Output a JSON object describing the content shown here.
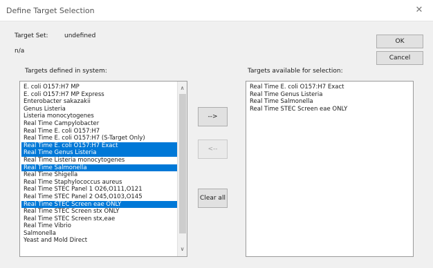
{
  "window": {
    "title": "Define Target Selection",
    "close_glyph": "✕"
  },
  "target_set": {
    "label": "Target Set:",
    "value": "undefined",
    "note": "n/a"
  },
  "buttons": {
    "ok": "OK",
    "cancel": "Cancel",
    "add": "-->",
    "remove": "<--",
    "clear_all": "Clear all"
  },
  "left_panel": {
    "label": "Targets defined in system:",
    "items": [
      {
        "text": "E. coli O157:H7 MP",
        "selected": false
      },
      {
        "text": "E. coli O157:H7 MP Express",
        "selected": false
      },
      {
        "text": "Enterobacter sakazakii",
        "selected": false
      },
      {
        "text": "Genus Listeria",
        "selected": false
      },
      {
        "text": "Listeria monocytogenes",
        "selected": false
      },
      {
        "text": "Real Time Campylobacter",
        "selected": false
      },
      {
        "text": "Real Time E. coli O157:H7",
        "selected": false
      },
      {
        "text": "Real Time E. coli O157:H7 (S-Target Only)",
        "selected": false
      },
      {
        "text": "Real Time E. coli O157:H7 Exact",
        "selected": true
      },
      {
        "text": "Real Time Genus Listeria",
        "selected": true
      },
      {
        "text": "Real Time Listeria monocytogenes",
        "selected": false
      },
      {
        "text": "Real Time Salmonella",
        "selected": true
      },
      {
        "text": "Real Time Shigella",
        "selected": false
      },
      {
        "text": "Real Time Staphylococcus aureus",
        "selected": false
      },
      {
        "text": "Real Time STEC Panel 1 O26,O111,O121",
        "selected": false
      },
      {
        "text": "Real Time STEC Panel 2 O45,O103,O145",
        "selected": false
      },
      {
        "text": "Real Time STEC Screen eae ONLY",
        "selected": true
      },
      {
        "text": "Real Time STEC Screen stx ONLY",
        "selected": false
      },
      {
        "text": "Real Time STEC Screen stx,eae",
        "selected": false
      },
      {
        "text": "Real Time Vibrio",
        "selected": false
      },
      {
        "text": "Salmonella",
        "selected": false
      },
      {
        "text": "Yeast and Mold Direct",
        "selected": false
      }
    ],
    "scroll_up_glyph": "∧",
    "scroll_down_glyph": "∨"
  },
  "right_panel": {
    "label": "Targets available for selection:",
    "items": [
      {
        "text": "Real Time E. coli O157:H7 Exact",
        "selected": false
      },
      {
        "text": "Real Time Genus Listeria",
        "selected": false
      },
      {
        "text": "Real Time Salmonella",
        "selected": false
      },
      {
        "text": "Real Time STEC Screen eae ONLY",
        "selected": false
      }
    ]
  },
  "colors": {
    "selection": "#0078d7",
    "window_bg": "#f0f0f0"
  },
  "icons": {
    "close": "close-icon",
    "scroll_up": "chevron-up-icon",
    "scroll_down": "chevron-down-icon"
  }
}
